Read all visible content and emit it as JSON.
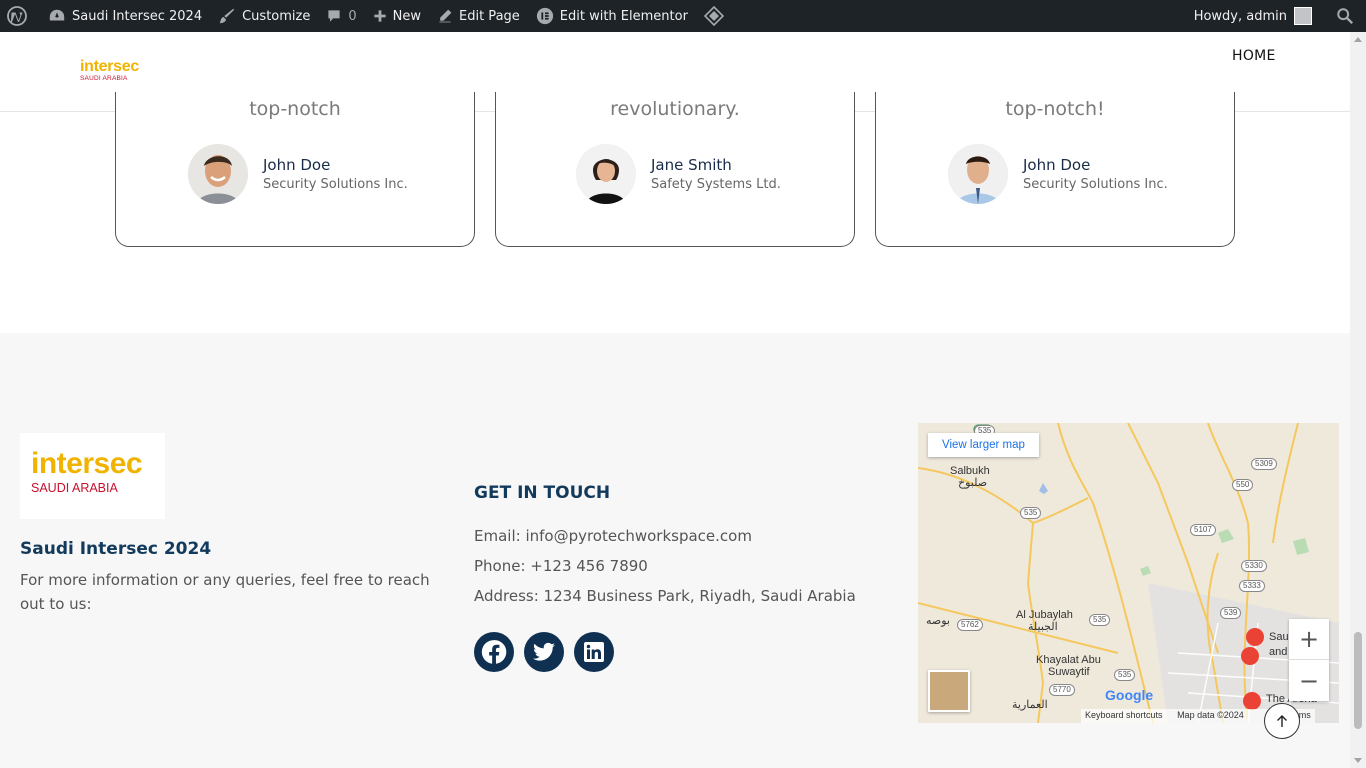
{
  "admin_bar": {
    "site_name": "Saudi Intersec 2024",
    "customize": "Customize",
    "comments_count": "0",
    "new": "New",
    "edit_page": "Edit Page",
    "edit_elementor": "Edit with Elementor",
    "howdy": "Howdy, admin"
  },
  "header": {
    "logo_text": "intersec",
    "logo_sub": "SAUDI ARABIA",
    "nav_home": "HOME"
  },
  "testimonials": [
    {
      "quote": "top-notch",
      "name": "John Doe",
      "company": "Security Solutions Inc."
    },
    {
      "quote": "revolutionary.",
      "name": "Jane Smith",
      "company": "Safety Systems Ltd."
    },
    {
      "quote": "top-notch!",
      "name": "John Doe",
      "company": "Security Solutions Inc."
    }
  ],
  "footer": {
    "logo_text": "intersec",
    "logo_sub": "SAUDI ARABIA",
    "title": "Saudi Intersec 2024",
    "description": "For more information or any queries, feel free to reach out to us:",
    "get_in_touch": "GET IN TOUCH",
    "email": "Email: info@pyrotechworkspace.com",
    "phone": "Phone: +123 456 7890",
    "address": "Address: 1234 Business Park, Riyadh, Saudi Arabia",
    "social_icons": [
      "facebook-icon",
      "twitter-icon",
      "linkedin-icon"
    ]
  },
  "map": {
    "view_larger": "View larger map",
    "labels": {
      "salbukh": "Salbukh",
      "salbukh_ar": "صلبوخ",
      "al_jubaylah": "Al Jubaylah",
      "al_jubaylah_ar": "الجبيلة",
      "khayalat": "Khayalat Abu",
      "suwaytif": "Suwaytif",
      "busa_ar": "بوصه",
      "amariyah_ar": "العمارية",
      "saudi": "Sau",
      "and": "and",
      "the_arena": "The Arena"
    },
    "road_badges": [
      "535",
      "550",
      "5309",
      "5107",
      "5330",
      "5333",
      "539",
      "535",
      "535",
      "5762",
      "5770",
      "535"
    ],
    "google": "Google",
    "keyboard": "Keyboard shortcuts",
    "map_data": "Map data ©2024",
    "terms": "Terms"
  },
  "colors": {
    "admin_bar": "#1d2327",
    "logo_yellow": "#f0b400",
    "logo_red": "#c8102e",
    "footer_heading": "#123a5c",
    "social_bg": "#0f3050"
  }
}
